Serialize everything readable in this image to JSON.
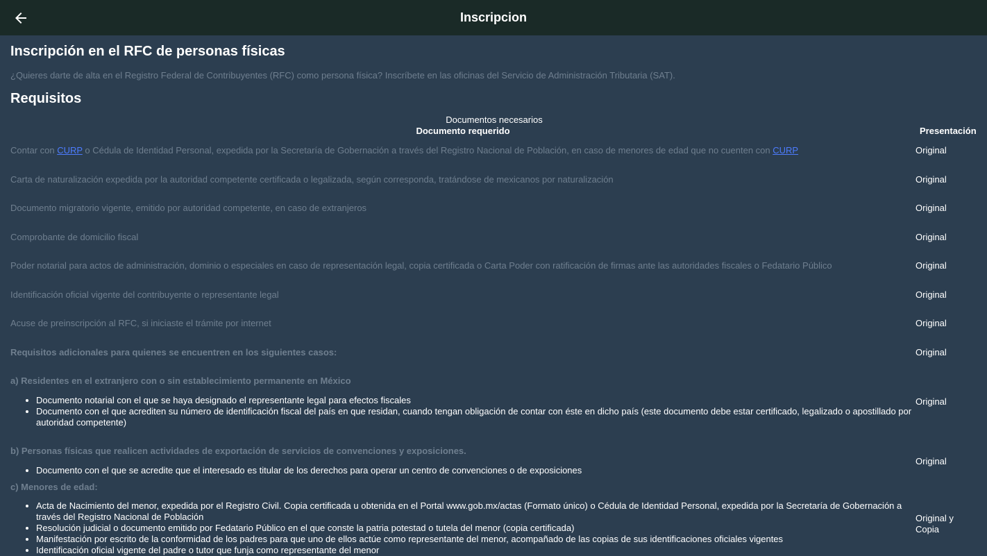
{
  "appbar": {
    "title": "Inscripcion",
    "back_icon": "arrow-left-icon"
  },
  "page": {
    "heading": "Inscripción en el RFC de personas físicas",
    "intro": "¿Quieres darte de alta en el Registro Federal de Contribuyentes (RFC) como persona física? Inscríbete en las oficinas del Servicio de Administración Tributaria (SAT).",
    "requirements_heading": "Requisitos"
  },
  "table": {
    "caption": "Documentos necesarios",
    "col_document": "Documento requerido",
    "col_presentation": "Presentación",
    "row1": {
      "t1": "Contar con ",
      "link1": "CURP",
      "t2": " o Cédula de Identidad Personal, expedida por la Secretaría de Gobernación a través del Registro Nacional de Población, en caso de menores de edad que no cuenten con ",
      "link2": "CURP",
      "pres": "Original"
    },
    "rows": [
      {
        "doc": "Carta de naturalización expedida por la autoridad competente certificada o legalizada, según corresponda, tratándose de mexicanos por naturalización",
        "pres": "Original"
      },
      {
        "doc": "Documento migratorio vigente, emitido por autoridad competente, en caso de extranjeros",
        "pres": "Original"
      },
      {
        "doc": "Comprobante de domicilio fiscal",
        "pres": "Original"
      },
      {
        "doc": "Poder notarial para actos de administración, dominio o especiales en caso de representación legal, copia certificada o Carta Poder con ratificación de firmas ante las autoridades fiscales o Fedatario Público",
        "pres": "Original"
      },
      {
        "doc": "Identificación oficial vigente del contribuyente o representante legal",
        "pres": "Original"
      },
      {
        "doc": "Acuse de preinscripción al RFC, si iniciaste el trámite por internet",
        "pres": "Original"
      }
    ],
    "additional": {
      "title": "Requisitos adicionales para quienes se encuentren en los siguientes casos:",
      "pres": "Original"
    },
    "section_a": {
      "title": "a) Residentes en el extranjero con o sin establecimiento permanente en México",
      "items": [
        "Documento notarial con el que se haya designado el representante legal para efectos fiscales",
        "Documento con el que acrediten su número de identificación fiscal del país en que residan, cuando tengan obligación de contar con éste en dicho país (este documento debe estar certificado, legalizado o apostillado por autoridad competente)"
      ],
      "pres": "Original"
    },
    "section_b": {
      "title": "b) Personas físicas que realicen actividades de exportación de servicios de convenciones y exposiciones.",
      "items": [
        "Documento con el que se acredite que el interesado es titular de los derechos para operar un centro de convenciones o de exposiciones"
      ],
      "pres": "Original"
    },
    "section_c": {
      "title": "c) Menores de edad:",
      "items": [
        "Acta de Nacimiento del menor, expedida por el Registro Civil. Copia certificada u obtenida en el Portal www.gob.mx/actas (Formato único) o Cédula de Identidad Personal, expedida por la Secretaría de Gobernación a través del Registro Nacional de Población",
        "Resolución judicial o documento emitido por Fedatario Público en el que conste la patria potestad o tutela del menor (copia certificada)",
        "Manifestación por escrito de la conformidad de los padres para que uno de ellos actúe como representante del menor, acompañado de las copias de sus identificaciones oficiales vigentes",
        "Identificación oficial vigente del padre o tutor que funja como representante del menor"
      ],
      "pres_line1": "Original y",
      "pres_line2": "Copia"
    }
  }
}
